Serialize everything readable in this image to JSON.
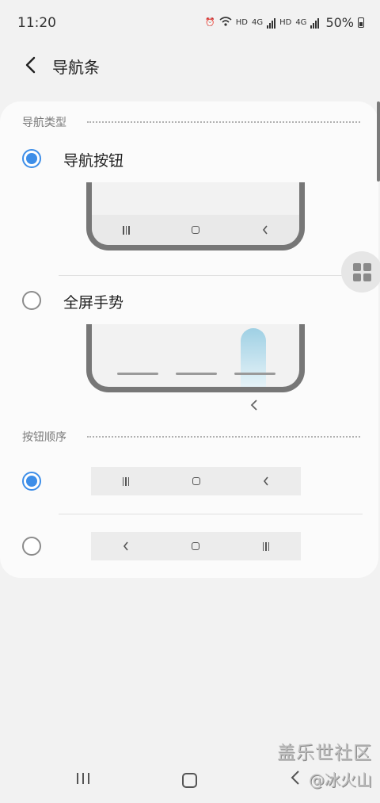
{
  "status": {
    "time": "11:20",
    "hd1": "HD",
    "net1": "4G",
    "hd2": "HD",
    "net2": "4G",
    "battery": "50%"
  },
  "header": {
    "back_glyph": "‹",
    "title": "导航条"
  },
  "section_type": {
    "title": "导航类型",
    "options": [
      {
        "label": "导航按钮",
        "selected": true
      },
      {
        "label": "全屏手势",
        "selected": false
      }
    ]
  },
  "section_order": {
    "title": "按钮顺序",
    "options": [
      {
        "order": [
          "recent",
          "home",
          "back"
        ],
        "selected": true
      },
      {
        "order": [
          "back",
          "home",
          "recent"
        ],
        "selected": false
      }
    ]
  },
  "preview": {
    "back_hint": "‹"
  },
  "icons": {
    "recent": "recent-apps-icon",
    "home": "home-icon",
    "back": "back-icon",
    "floating": "grid-icon"
  },
  "colors": {
    "accent": "#3d8ee8",
    "card": "#fbfbfb",
    "background": "#f2f2f2"
  },
  "watermark": {
    "title": "盖乐世社区",
    "author": "@冰火山"
  }
}
